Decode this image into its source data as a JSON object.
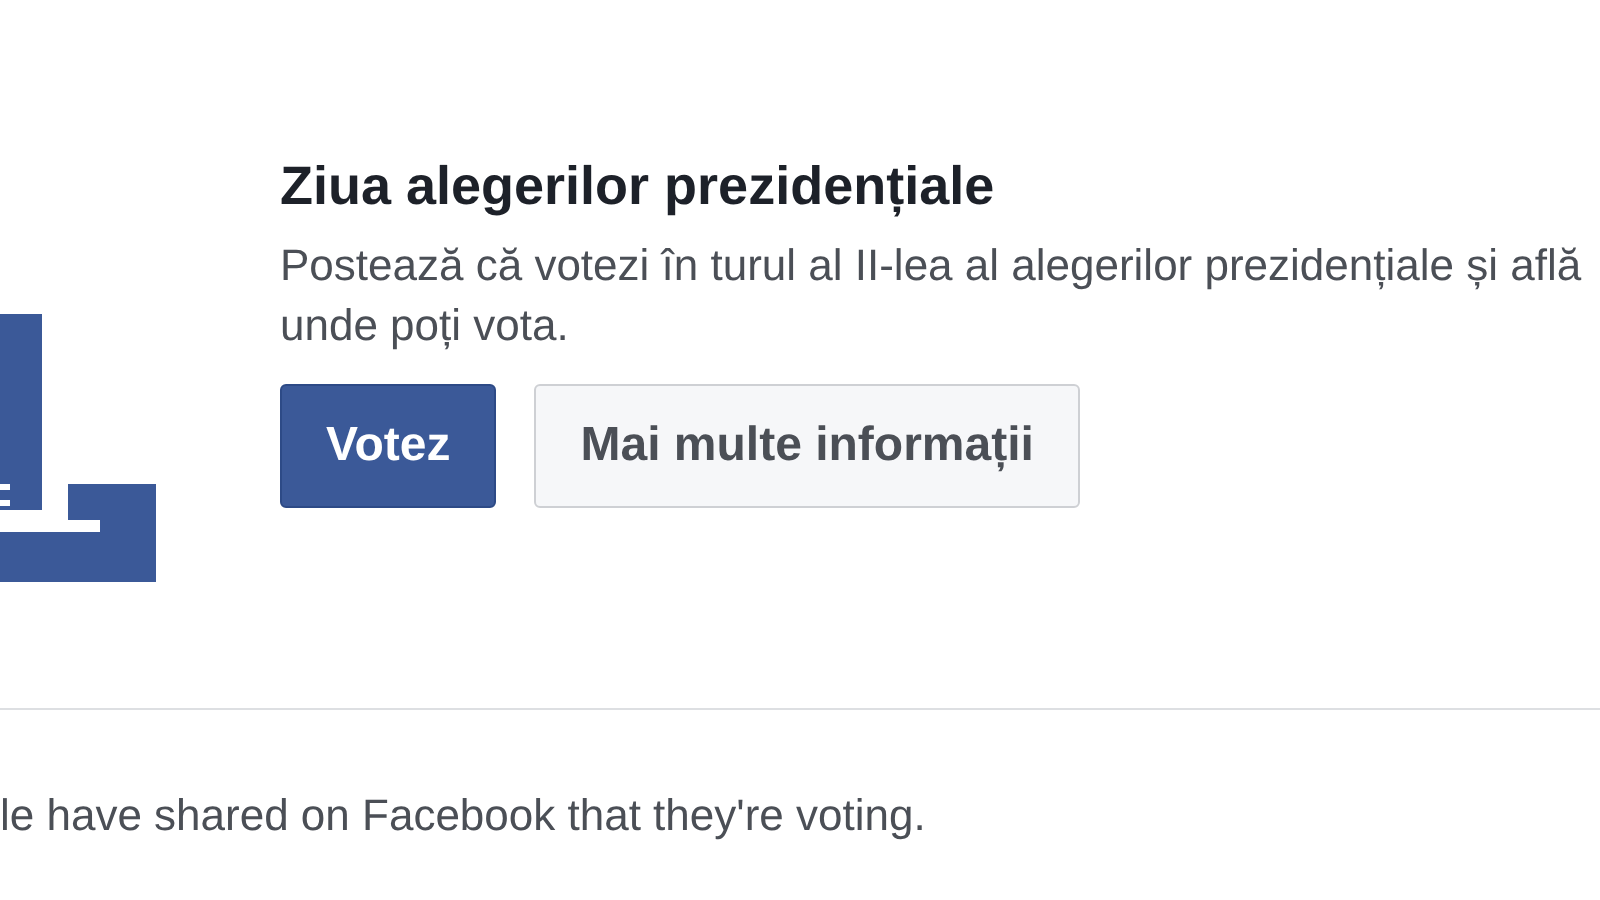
{
  "prompt": {
    "title": "Ziua alegerilor prezidențiale",
    "description": "Postează că votezi în turul al II-lea al alegerilor prezidențiale și află unde poți vota.",
    "buttons": [
      {
        "label": "Votez",
        "kind": "primary"
      },
      {
        "label": "Mai multe informații",
        "kind": "secondary"
      }
    ]
  },
  "footer": {
    "text": "le have shared on Facebook that they're voting."
  }
}
